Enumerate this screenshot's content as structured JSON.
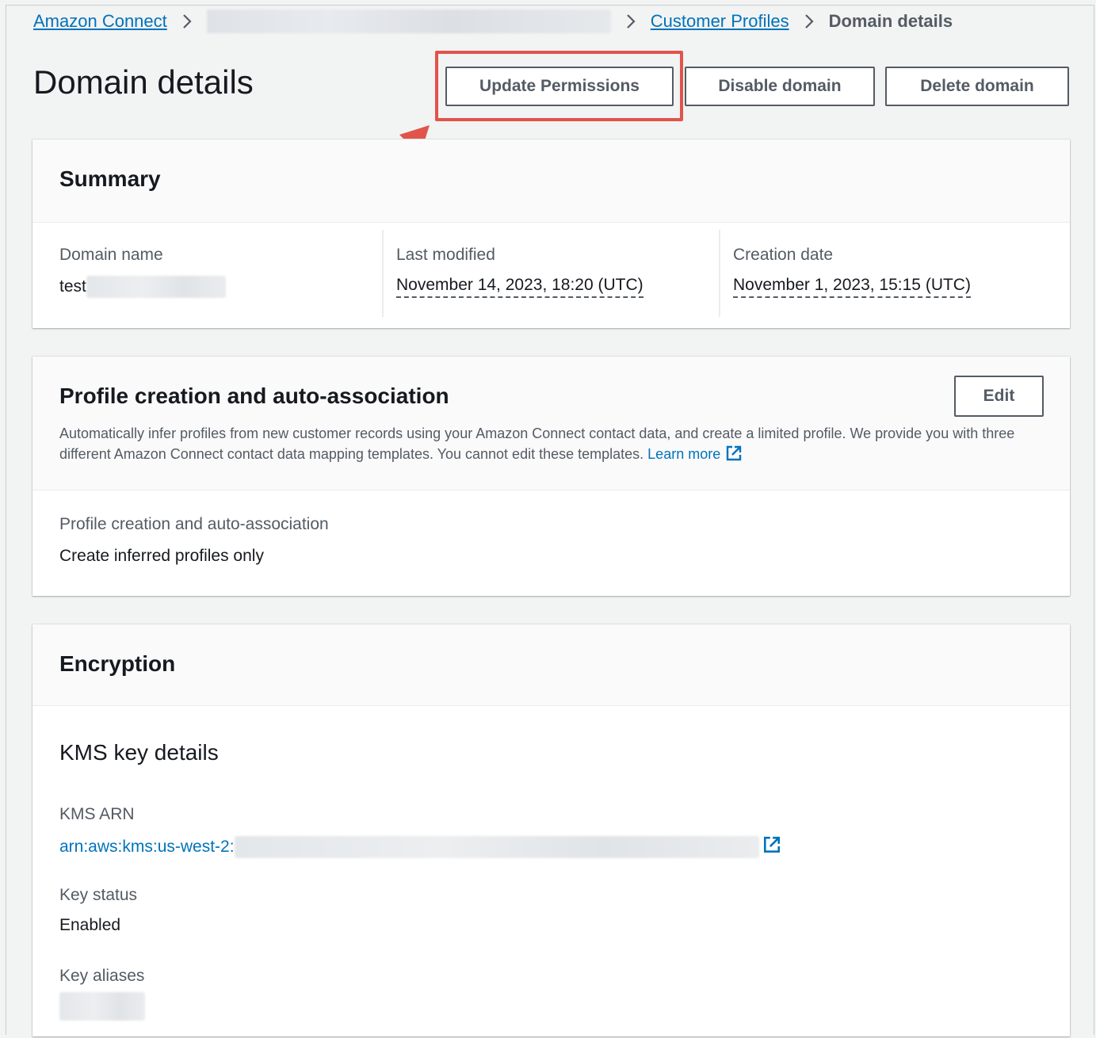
{
  "breadcrumb": {
    "root": "Amazon Connect",
    "middle": "Customer Profiles",
    "current": "Domain details"
  },
  "header": {
    "title": "Domain details",
    "buttons": {
      "update_permissions": "Update Permissions",
      "disable_domain": "Disable domain",
      "delete_domain": "Delete domain"
    }
  },
  "annotation": {
    "highlight_color": "#e0544b"
  },
  "summary": {
    "title": "Summary",
    "domain_name_label": "Domain name",
    "domain_name_value": "test",
    "last_modified_label": "Last modified",
    "last_modified_value": "November 14, 2023, 18:20 (UTC)",
    "creation_date_label": "Creation date",
    "creation_date_value": "November 1, 2023, 15:15 (UTC)"
  },
  "profile_creation": {
    "title": "Profile creation and auto-association",
    "edit_label": "Edit",
    "description": "Automatically infer profiles from new customer records using your Amazon Connect contact data, and create a limited profile. We provide you with three different Amazon Connect contact data mapping templates. You cannot edit these templates.",
    "learn_more": "Learn more",
    "field_label": "Profile creation and auto-association",
    "field_value": "Create inferred profiles only"
  },
  "encryption": {
    "title": "Encryption",
    "kms_heading": "KMS key details",
    "kms_arn_label": "KMS ARN",
    "kms_arn_value": "arn:aws:kms:us-west-2:",
    "key_status_label": "Key status",
    "key_status_value": "Enabled",
    "key_aliases_label": "Key aliases"
  },
  "colors": {
    "link": "#0073bb",
    "text": "#16191f",
    "secondary_text": "#545b64",
    "page_bg": "#f2f3f3"
  }
}
